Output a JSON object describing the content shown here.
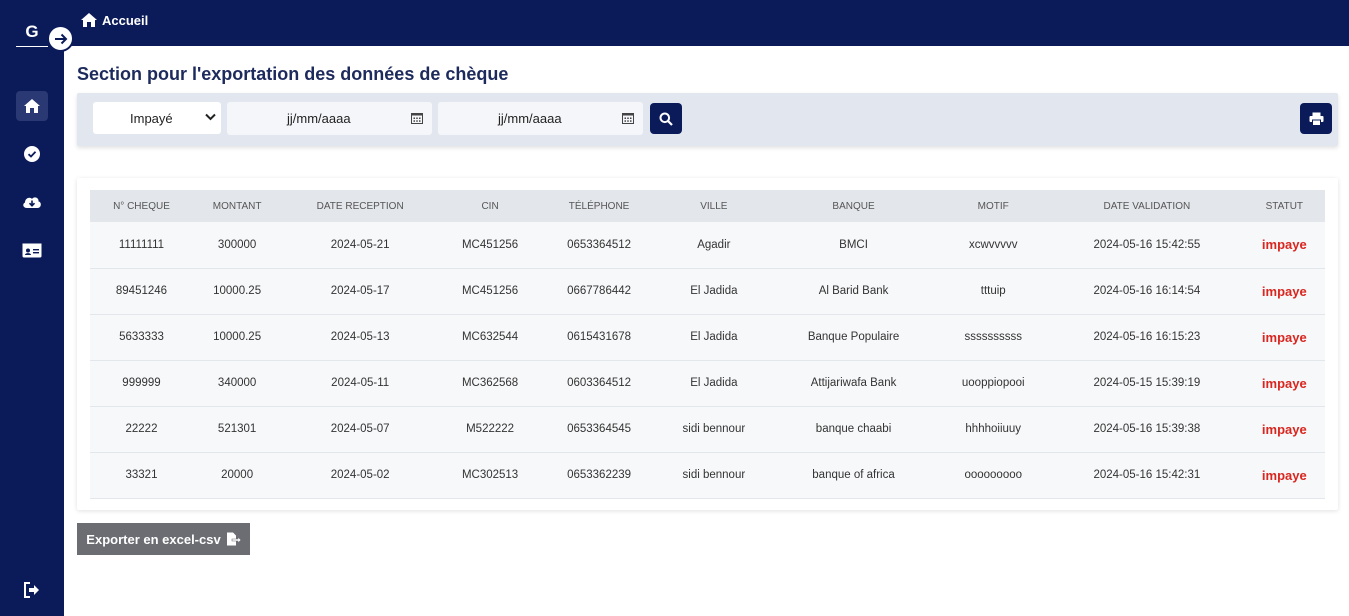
{
  "sidebar": {
    "logo": "G",
    "items": [
      {
        "name": "home-icon",
        "active": true
      },
      {
        "name": "check-circle-icon",
        "active": false
      },
      {
        "name": "cloud-download-icon",
        "active": false
      },
      {
        "name": "id-card-icon",
        "active": false
      }
    ],
    "logout_icon": "sign-out-icon",
    "toggle_icon": "arrow-right-icon"
  },
  "topbar": {
    "breadcrumb": "Accueil"
  },
  "page": {
    "title": "Section pour l'exportation des données de chèque"
  },
  "filters": {
    "status_selected": "Impayé",
    "date_from_placeholder": "jj/mm/aaaa",
    "date_to_placeholder": "jj/mm/aaaa",
    "search_icon": "search-icon",
    "print_icon": "print-icon"
  },
  "table": {
    "headers": [
      "N° CHEQUE",
      "MONTANT",
      "DATE RECEPTION",
      "CIN",
      "TÉLÉPHONE",
      "VILLE",
      "BANQUE",
      "MOTIF",
      "DATE VALIDATION",
      "STATUT"
    ],
    "rows": [
      [
        "11111111",
        "300000",
        "2024-05-21",
        "MC451256",
        "0653364512",
        "Agadir",
        "BMCI",
        "xcwvvvvv",
        "2024-05-16 15:42:55",
        "impaye"
      ],
      [
        "89451246",
        "10000.25",
        "2024-05-17",
        "MC451256",
        "0667786442",
        "El Jadida",
        "Al Barid Bank",
        "tttuip",
        "2024-05-16 16:14:54",
        "impaye"
      ],
      [
        "5633333",
        "10000.25",
        "2024-05-13",
        "MC632544",
        "0615431678",
        "El Jadida",
        "Banque Populaire",
        "ssssssssss",
        "2024-05-16 16:15:23",
        "impaye"
      ],
      [
        "999999",
        "340000",
        "2024-05-11",
        "MC362568",
        "0603364512",
        "El Jadida",
        "Attijariwafa Bank",
        "uooppiopooi",
        "2024-05-15 15:39:19",
        "impaye"
      ],
      [
        "22222",
        "521301",
        "2024-05-07",
        "M522222",
        "0653364545",
        "sidi bennour",
        "banque chaabi",
        "hhhhoiiuuy",
        "2024-05-16 15:39:38",
        "impaye"
      ],
      [
        "33321",
        "20000",
        "2024-05-02",
        "MC302513",
        "0653362239",
        "sidi bennour",
        "banque of africa",
        "ooooooooo",
        "2024-05-16 15:42:31",
        "impaye"
      ]
    ]
  },
  "export": {
    "label": "Exporter en excel-csv",
    "icon": "file-export-icon"
  },
  "colors": {
    "navy": "#0b1b5a",
    "status_red": "#d9261f",
    "filter_bg": "#e2e7ef",
    "export_btn": "#6b6d72"
  }
}
